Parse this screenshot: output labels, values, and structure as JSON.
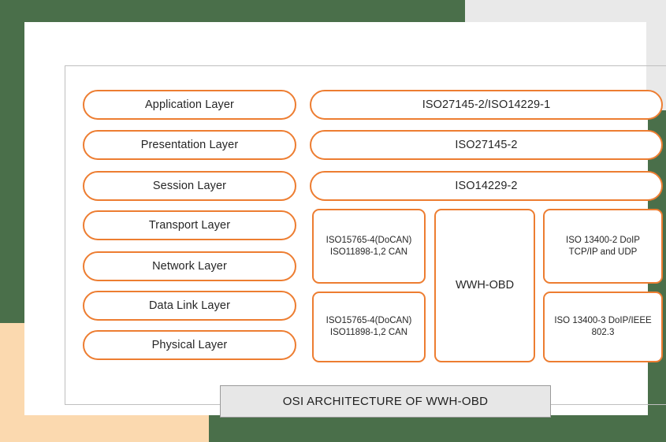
{
  "colors": {
    "accent_orange": "#ED7D31",
    "background_green": "#4a6f4a",
    "background_gray": "#e9e9e9",
    "background_peach": "#fbd9af",
    "card_white": "#ffffff",
    "frame_gray": "#bfbfbf",
    "caption_fill": "#e7e7e7",
    "text_dark": "#262626"
  },
  "osi_layers": [
    {
      "label": "Application Layer"
    },
    {
      "label": "Presentation Layer"
    },
    {
      "label": "Session Layer"
    },
    {
      "label": "Transport Layer"
    },
    {
      "label": "Network Layer"
    },
    {
      "label": "Data Link Layer"
    },
    {
      "label": "Physical Layer"
    }
  ],
  "protocol_pills": [
    {
      "label": "ISO27145-2/ISO14229-1"
    },
    {
      "label": "ISO27145-2"
    },
    {
      "label": "ISO14229-2"
    }
  ],
  "protocol_boxes": {
    "can_upper": "ISO15765-4(DoCAN)\nISO11898-1,2 CAN",
    "can_lower": "ISO15765-4(DoCAN)\nISO11898-1,2 CAN",
    "wwh_obd": "WWH-OBD",
    "doip_tcp": "ISO 13400-2 DoIP\nTCP/IP and UDP",
    "doip_ieee": "ISO 13400-3 DoIP/IEEE\n802.3"
  },
  "caption": {
    "title": "OSI ARCHITECTURE OF WWH-OBD"
  }
}
